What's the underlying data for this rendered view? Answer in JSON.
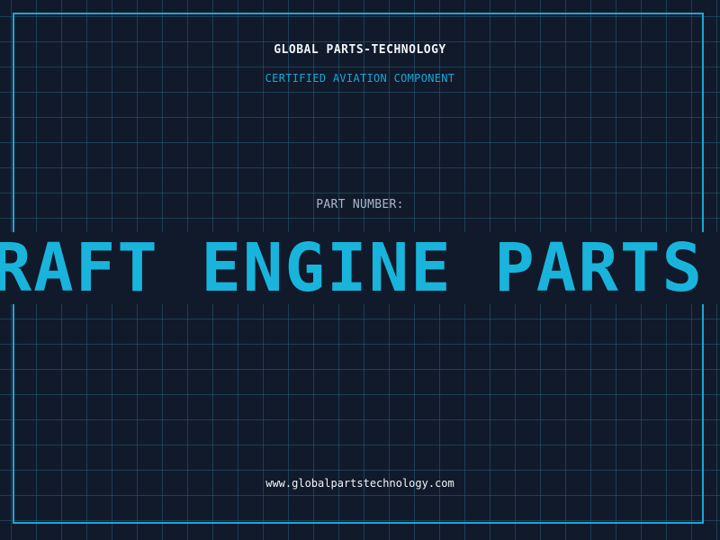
{
  "header": {
    "company": "GLOBAL PARTS-TECHNOLOGY",
    "subtitle": "CERTIFIED AVIATION COMPONENT"
  },
  "part": {
    "label": "PART NUMBER:",
    "value": "AIRCRAFT ENGINE PARTS"
  },
  "footer": {
    "website": "www.globalpartstechnology.com"
  },
  "colors": {
    "background": "#111a2b",
    "grid": "#265c78",
    "accent": "#1aa7d6",
    "text_primary": "#f2f5f8",
    "text_muted": "#a8b8c8"
  }
}
